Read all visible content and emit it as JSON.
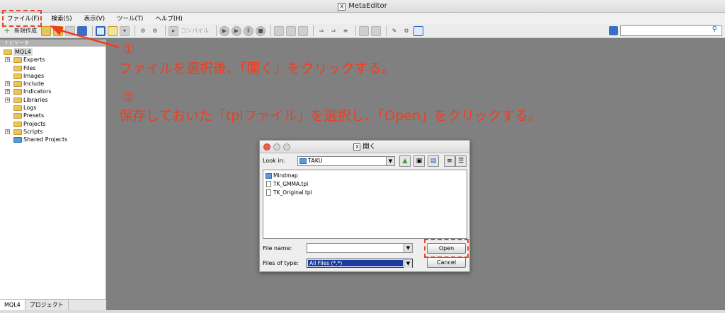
{
  "window": {
    "title": "MetaEditor",
    "logo": "X"
  },
  "menu": [
    "ファイル(F)",
    "検索(S)",
    "表示(V)",
    "ツール(T)",
    "ヘルプ(H)"
  ],
  "toolbar": {
    "new_label": "新規作成",
    "compile_label": "コンパイル"
  },
  "search": {
    "value": ""
  },
  "navigator": {
    "title": "ナビゲータ",
    "root": "MQL4",
    "items": [
      {
        "label": "Experts",
        "expandable": true
      },
      {
        "label": "Files",
        "expandable": false
      },
      {
        "label": "Images",
        "expandable": false
      },
      {
        "label": "Include",
        "expandable": true
      },
      {
        "label": "Indicators",
        "expandable": true
      },
      {
        "label": "Libraries",
        "expandable": true
      },
      {
        "label": "Logs",
        "expandable": false
      },
      {
        "label": "Presets",
        "expandable": false
      },
      {
        "label": "Projects",
        "expandable": false
      },
      {
        "label": "Scripts",
        "expandable": true
      },
      {
        "label": "Shared Projects",
        "expandable": false,
        "blue": true
      }
    ],
    "tabs": [
      "MQL4",
      "プロジェクト"
    ]
  },
  "annotations": {
    "step1_num": "①",
    "step1_text": "ファイルを選択後、「開く」をクリックする。",
    "step2_num": "②",
    "step2_text": "保存しておいた「tplファイル」を選択し、「Open」をクリックする。",
    "color": "#ef3d1f"
  },
  "dialog": {
    "title": "開く",
    "logo": "X",
    "look_in_label": "Look in:",
    "look_in_value": "TAKU",
    "files": [
      {
        "name": "Mindmap",
        "type": "folder"
      },
      {
        "name": "TK_GMMA.tpl",
        "type": "file"
      },
      {
        "name": "TK_Original.tpl",
        "type": "file"
      }
    ],
    "file_name_label": "File name:",
    "file_name_value": "",
    "file_type_label": "Files of type:",
    "file_type_value": "All Files (*.*)",
    "open_button": "Open",
    "cancel_button": "Cancel"
  }
}
